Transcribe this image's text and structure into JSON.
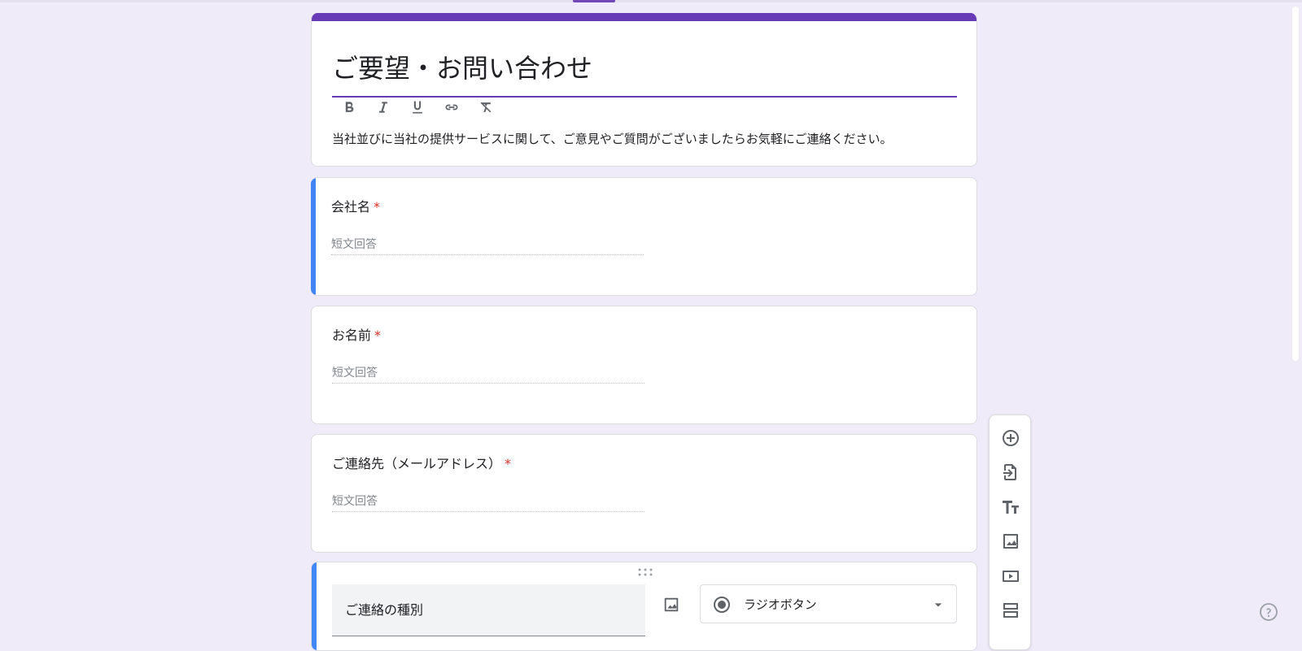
{
  "form": {
    "title": "ご要望・お問い合わせ",
    "description": "当社並びに当社の提供サービスに関して、ご意見やご質問がございましたらお気軽にご連絡ください。",
    "format_toolbar": [
      "bold-icon",
      "italic-icon",
      "underline-icon",
      "link-icon",
      "clear-format-icon"
    ]
  },
  "questions": [
    {
      "title": "会社名",
      "required_mark": "*",
      "placeholder": "短文回答"
    },
    {
      "title": "お名前",
      "required_mark": "*",
      "placeholder": "短文回答"
    },
    {
      "title": "ご連絡先（メールアドレス）",
      "required_mark": "*",
      "placeholder": "短文回答"
    }
  ],
  "editing_question": {
    "title": "ご連絡の種別",
    "type_label": "ラジオボタン"
  },
  "side_toolbar": [
    "add-question-icon",
    "import-questions-icon",
    "add-title-icon",
    "add-image-icon",
    "add-video-icon",
    "add-section-icon"
  ],
  "colors": {
    "accent": "#673ab7",
    "background": "#f0ebf8",
    "active": "#4285f4",
    "required": "#d93025"
  }
}
